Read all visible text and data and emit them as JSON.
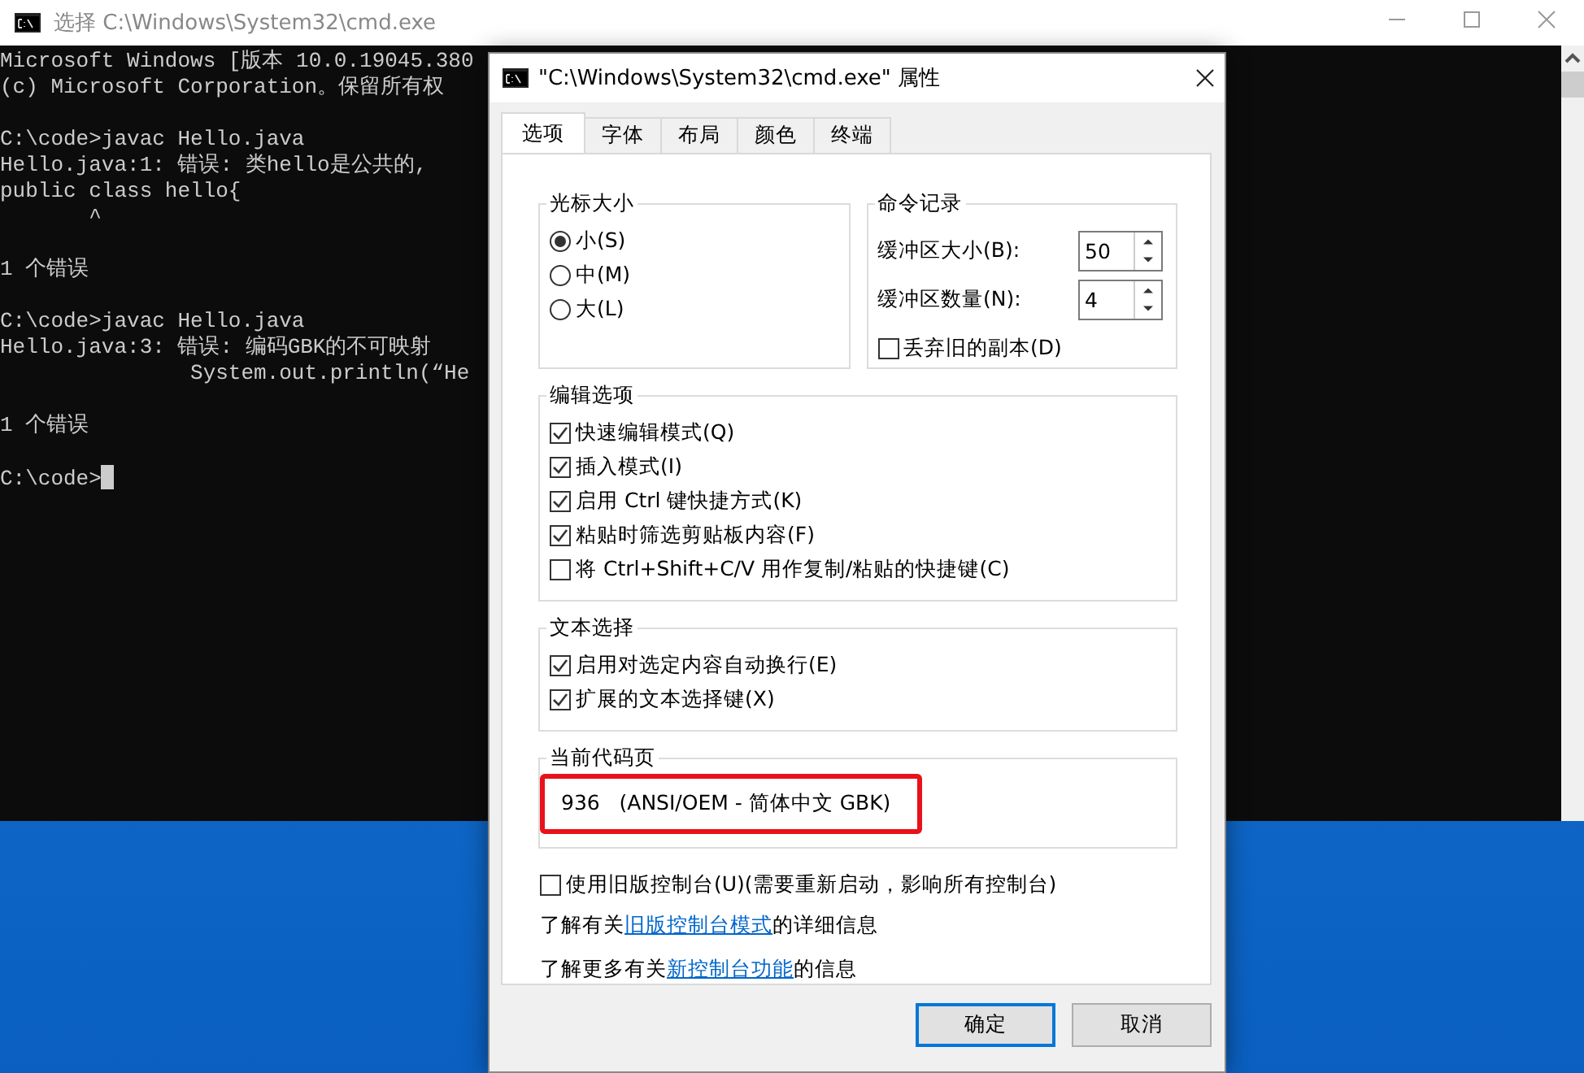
{
  "console_window": {
    "title": "选择 C:\\Windows\\System32\\cmd.exe",
    "blocks": [
      [
        "Microsoft Windows [版本 10.0.19045.380",
        "(c) Microsoft Corporation。保留所有权"
      ],
      [
        "C:\\code>javac Hello.java",
        "Hello.java:1: 错误: 类hello是公共的,",
        "public class hello{",
        "       ^"
      ],
      [
        "1 个错误"
      ],
      [
        "C:\\code>javac Hello.java",
        "Hello.java:3: 错误: 编码GBK的不可映射",
        "               System.out.println(“He"
      ],
      [
        "1 个错误"
      ],
      [
        "C:\\code>"
      ]
    ]
  },
  "dialog": {
    "title": "\"C:\\Windows\\System32\\cmd.exe\" 属性",
    "tabs": [
      {
        "label": "选项",
        "selected": true
      },
      {
        "label": "字体",
        "selected": false
      },
      {
        "label": "布局",
        "selected": false
      },
      {
        "label": "颜色",
        "selected": false
      },
      {
        "label": "终端",
        "selected": false
      }
    ],
    "cursor_size": {
      "title": "光标大小",
      "options": [
        {
          "label": "小(S)",
          "selected": true
        },
        {
          "label": "中(M)",
          "selected": false
        },
        {
          "label": "大(L)",
          "selected": false
        }
      ]
    },
    "command_history": {
      "title": "命令记录",
      "fields": [
        {
          "label": "缓冲区大小(B):",
          "value": "50"
        },
        {
          "label": "缓冲区数量(N):",
          "value": "4"
        }
      ],
      "discard": {
        "label": "丢弃旧的副本(D)",
        "checked": false
      }
    },
    "edit_options": {
      "title": "编辑选项",
      "items": [
        {
          "label": "快速编辑模式(Q)",
          "checked": true
        },
        {
          "label": "插入模式(I)",
          "checked": true
        },
        {
          "label": "启用 Ctrl 键快捷方式(K)",
          "checked": true
        },
        {
          "label": "粘贴时筛选剪贴板内容(F)",
          "checked": true
        },
        {
          "label": "将 Ctrl+Shift+C/V 用作复制/粘贴的快捷键(C)",
          "checked": false
        }
      ]
    },
    "text_selection": {
      "title": "文本选择",
      "items": [
        {
          "label": "启用对选定内容自动换行(E)",
          "checked": true
        },
        {
          "label": "扩展的文本选择键(X)",
          "checked": true
        }
      ]
    },
    "code_page": {
      "title": "当前代码页",
      "value": "936   (ANSI/OEM - 简体中文 GBK)",
      "highlighted": true
    },
    "legacy": {
      "label": "使用旧版控制台(U)(需要重新启动，影响所有控制台)",
      "checked": false
    },
    "links": [
      {
        "before": "了解有关",
        "link": "旧版控制台模式",
        "after": "的详细信息"
      },
      {
        "before": "了解更多有关",
        "link": "新控制台功能",
        "after": "的信息"
      }
    ],
    "buttons": [
      {
        "label": "确定",
        "default": true
      },
      {
        "label": "取消",
        "default": false
      }
    ]
  }
}
